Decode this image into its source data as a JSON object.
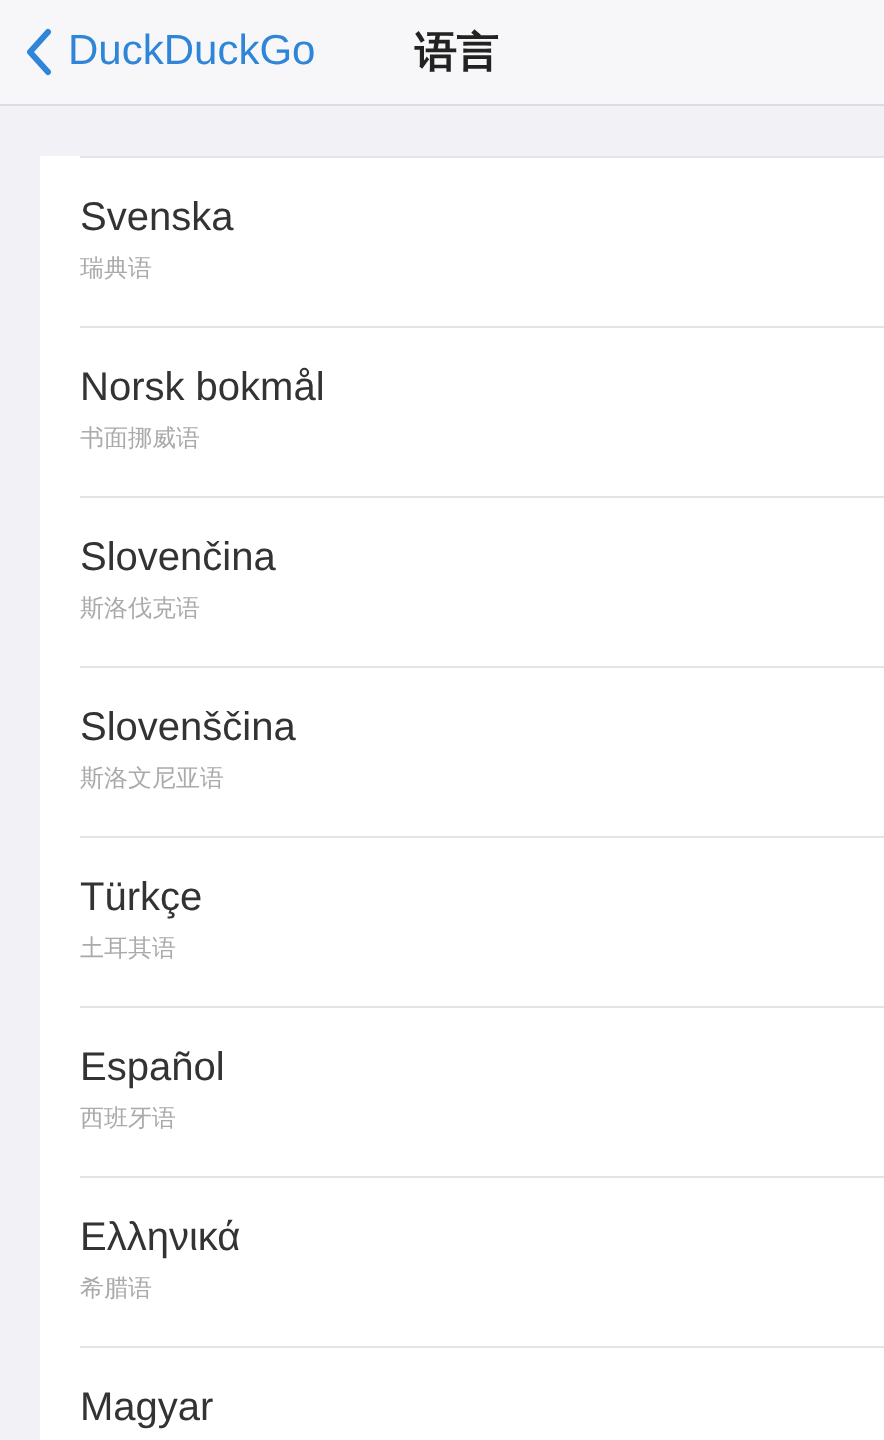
{
  "nav_bar": {
    "back_label": "DuckDuckGo",
    "title": "语言"
  },
  "languages": [
    {
      "name": "Svenska",
      "subtitle": "瑞典语"
    },
    {
      "name": "Norsk bokmål",
      "subtitle": "书面挪威语"
    },
    {
      "name": "Slovenčina",
      "subtitle": "斯洛伐克语"
    },
    {
      "name": "Slovenščina",
      "subtitle": "斯洛文尼亚语"
    },
    {
      "name": "Türkçe",
      "subtitle": "土耳其语"
    },
    {
      "name": "Español",
      "subtitle": "西班牙语"
    },
    {
      "name": "Ελληνικά",
      "subtitle": "希腊语"
    },
    {
      "name": "Magyar"
    }
  ]
}
